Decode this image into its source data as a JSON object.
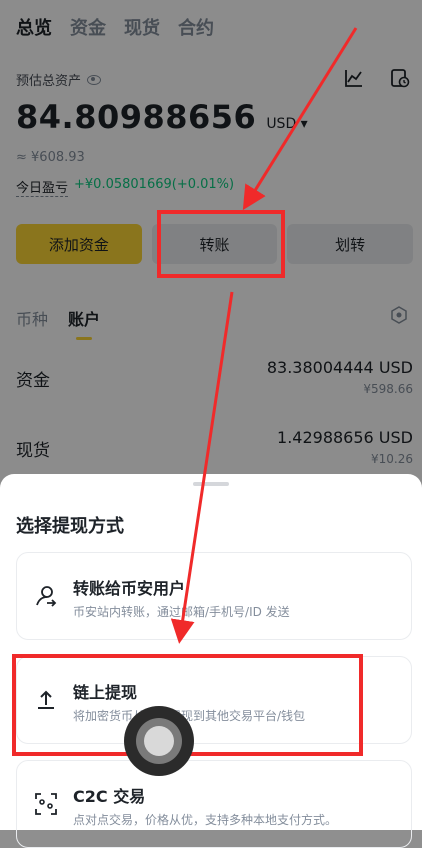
{
  "top_tabs": [
    "总览",
    "资金",
    "现货",
    "合约"
  ],
  "estimated_label": "预估总资产",
  "balance": {
    "value": "84.80988656",
    "currency": "USD ▾"
  },
  "approx_cny": "≈ ¥608.93",
  "pnl": {
    "label": "今日盈亏",
    "value": "+¥0.05801669(+0.01%)"
  },
  "actions": {
    "add": "添加资金",
    "transfer": "转账",
    "move": "划转"
  },
  "sub_tabs": [
    "币种",
    "账户"
  ],
  "accounts": [
    {
      "name": "资金",
      "usd": "83.38004444 USD",
      "cny": "¥598.66"
    },
    {
      "name": "现货",
      "usd": "1.42988656 USD",
      "cny": "¥10.26"
    }
  ],
  "sheet": {
    "title": "选择提现方式",
    "options": [
      {
        "title": "转账给币安用户",
        "desc": "币安站内转账，通过邮箱/手机号/ID 发送",
        "icon": "user-send-icon"
      },
      {
        "title": "链上提现",
        "desc": "将加密货币从币安提现到其他交易平台/钱包",
        "icon": "upload-icon"
      },
      {
        "title": "C2C 交易",
        "desc": "点对点交易，价格从优，支持多种本地支付方式。",
        "icon": "c2c-icon"
      }
    ]
  },
  "colors": {
    "accent": "#fcd535",
    "positive": "#0ecb81",
    "annotation": "#f02a2a"
  }
}
